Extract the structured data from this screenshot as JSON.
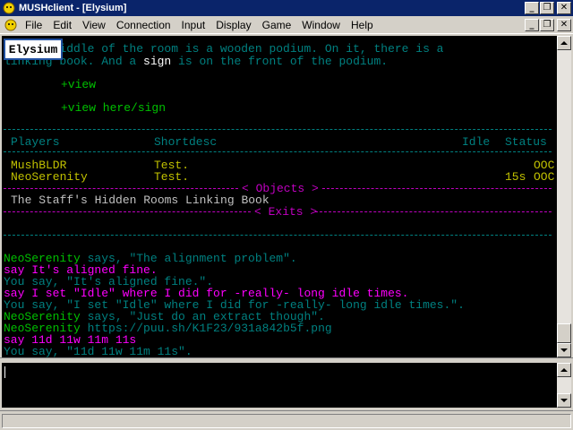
{
  "window": {
    "title": "MUSHclient - [Elysium]"
  },
  "menu": [
    "File",
    "Edit",
    "View",
    "Connection",
    "Input",
    "Display",
    "Game",
    "Window",
    "Help"
  ],
  "world_badge": "Elysium",
  "room": {
    "desc_line1": "In the middle of the room is a wooden podium. On it, there is a",
    "desc_line2_a": "linking book. And a ",
    "desc_line2_sign": "sign",
    "desc_line2_b": " is on the front of the podium.",
    "cmd1": "+view",
    "cmd2": "+view here/sign"
  },
  "players_table": {
    "headers": {
      "players": "Players",
      "shortdesc": "Shortdesc",
      "idle": "Idle",
      "status": "Status"
    },
    "rows": [
      {
        "name": "MushBLDR",
        "shortdesc": "Test.",
        "idle": "",
        "status": "OOC"
      },
      {
        "name": "NeoSerenity",
        "shortdesc": "Test.",
        "idle": "15s",
        "status": "OOC"
      }
    ]
  },
  "objects": {
    "header": "< Objects >",
    "items": [
      "The Staff's Hidden Rooms Linking Book"
    ]
  },
  "exits": {
    "header": "< Exits >"
  },
  "chat": {
    "l1_name": "NeoSerenity",
    "l1_says": " says, ",
    "l1_text": "\"The alignment problem\".",
    "l2": "say It's aligned fine.",
    "l3": "You say, \"It's aligned fine.\".",
    "l4": "say I set \"Idle\" where I did for -really- long idle times.",
    "l5": "You say, \"I set \"Idle\" where I did for -really- long idle times.\".",
    "l6_name": "NeoSerenity",
    "l6_says": " says, ",
    "l6_text": "\"Just do an extract though\".",
    "l7_name": "NeoSerenity",
    "l7_text": " https://puu.sh/K1F23/931a842b5f.png",
    "l8": "say 11d 11w 11m 11s",
    "l9": "You say, \"11d 11w 11m 11s\"."
  }
}
